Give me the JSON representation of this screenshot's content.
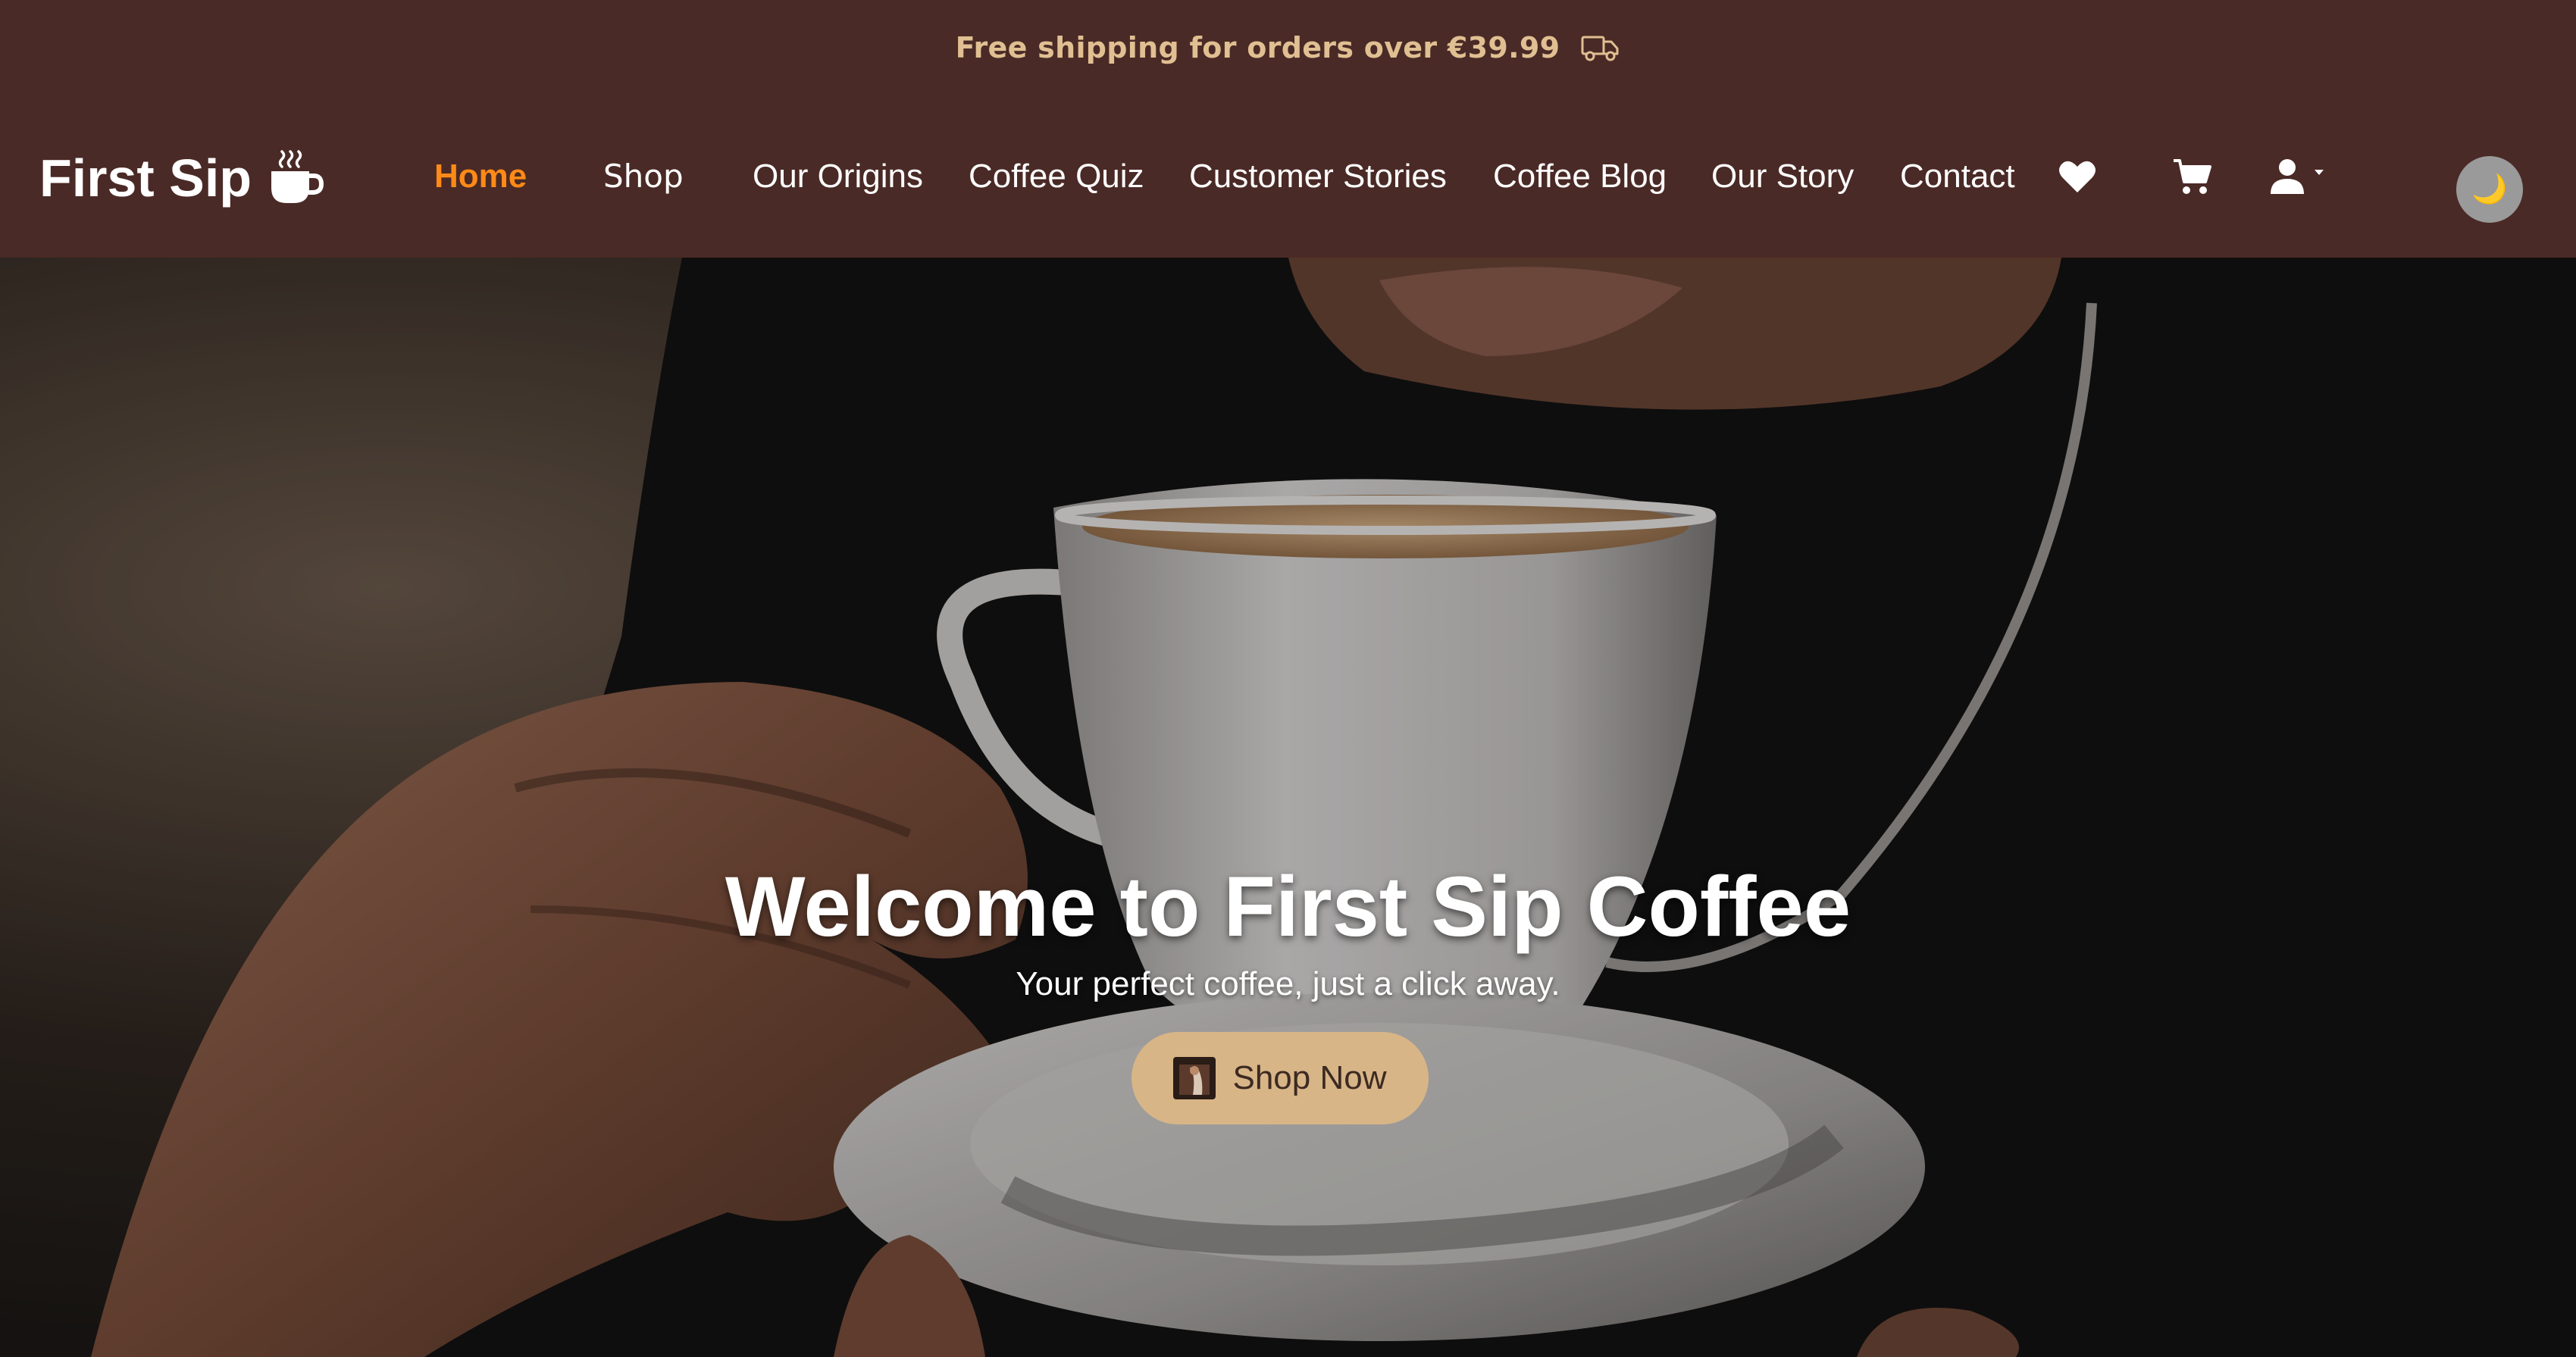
{
  "promo": {
    "text": "Free shipping for orders over €39.99",
    "icon": "truck-icon"
  },
  "nav": {
    "brand": "First Sip",
    "brand_icon": "coffee-cup-icon",
    "links": [
      {
        "label": "Home",
        "active": true
      },
      {
        "label": "Shop",
        "active": false
      },
      {
        "label": "Our Origins",
        "active": false
      },
      {
        "label": "Coffee Quiz",
        "active": false
      },
      {
        "label": "Customer Stories",
        "active": false
      },
      {
        "label": "Coffee Blog",
        "active": false
      },
      {
        "label": "Our Story",
        "active": false
      },
      {
        "label": "Contact",
        "active": false
      }
    ],
    "icons": [
      "heart-icon",
      "cart-icon",
      "user-icon",
      "moon-icon"
    ],
    "theme_toggle_glyph": "🌙"
  },
  "hero": {
    "title": "Welcome to First Sip Coffee",
    "subtitle": "Your perfect coffee, just a click away.",
    "cta_label": "Shop Now"
  },
  "colors": {
    "header_bg": "#4a2a26",
    "promo_text": "#e0bf92",
    "active_link": "#ff8a17",
    "cta_bg": "#d8b587"
  }
}
